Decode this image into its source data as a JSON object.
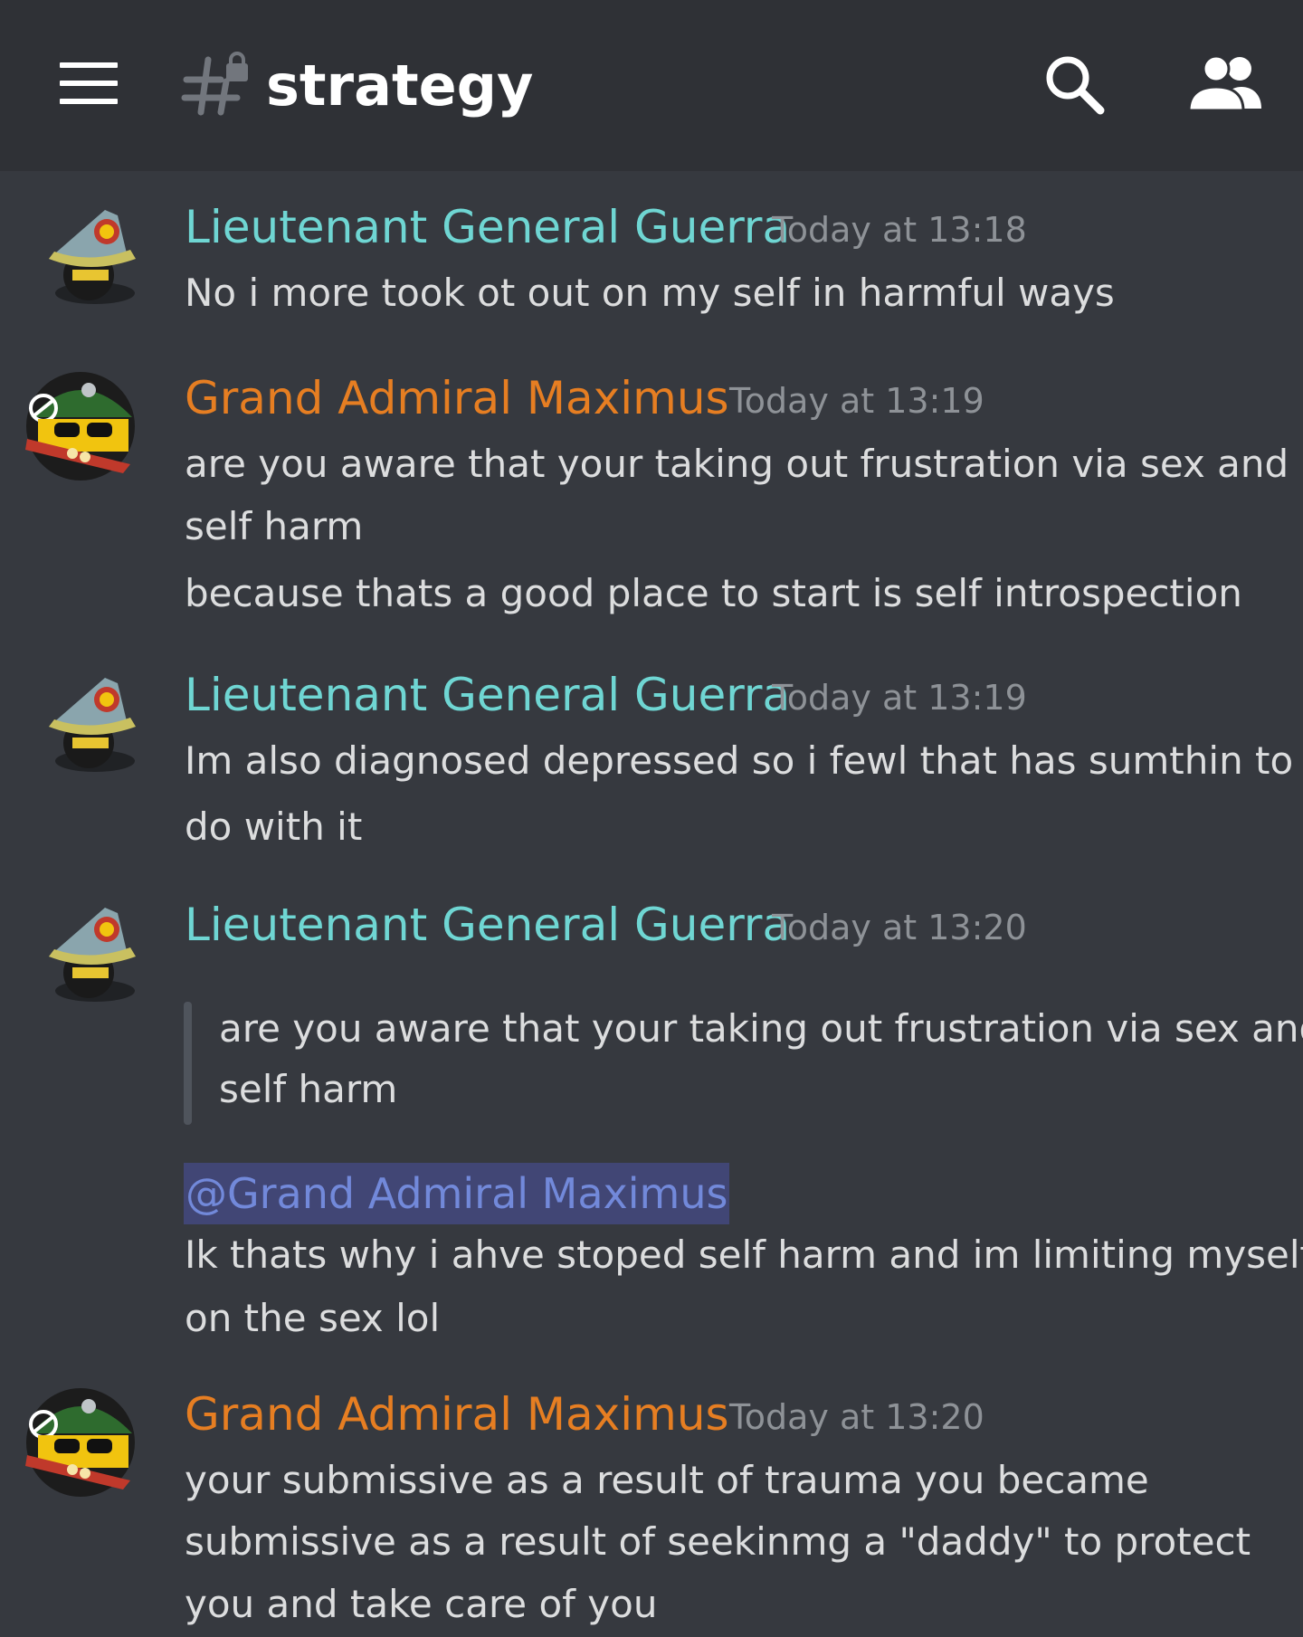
{
  "header": {
    "channel_name": "strategy",
    "menu_icon": "hamburger-menu-icon",
    "channel_icon": "locked-text-channel-icon",
    "search_icon": "search-icon",
    "members_icon": "members-icon"
  },
  "colors": {
    "header_bg": "#2f3136",
    "chat_bg": "#36393f",
    "name_teal": "#6fd6d3",
    "name_orange": "#e67e22",
    "mention_text": "#7289da",
    "mention_bg": "#414675"
  },
  "messages": [
    {
      "author": "Lieutenant General Guerra",
      "timestamp": "Today at 13:18",
      "lines": [
        "No i more took ot out on my self in harmful ways"
      ]
    },
    {
      "author": "Grand Admiral Maximus",
      "timestamp": "Today at 13:19",
      "lines": [
        "are you aware that your taking out frustration via sex and",
        "self harm",
        "because thats a good place to start is self introspection"
      ]
    },
    {
      "author": "Lieutenant General Guerra",
      "timestamp": "Today at 13:19",
      "lines": [
        "Im also diagnosed depressed so i fewl that has sumthin to",
        "do with it"
      ]
    },
    {
      "author": "Lieutenant General Guerra",
      "timestamp": "Today at 13:20",
      "quote_lines": [
        "are you aware that your taking out frustration via sex and",
        "self harm"
      ],
      "mention": "@Grand Admiral Maximus",
      "lines": [
        "Ik thats why i ahve stoped self harm and im limiting myself",
        "on the sex lol"
      ]
    },
    {
      "author": "Grand Admiral Maximus",
      "timestamp": "Today at 13:20",
      "lines": [
        "your submissive as a result of trauma you became",
        "submissive as a result of seekinmg a \"daddy\" to protect",
        "you and take care of you"
      ]
    }
  ]
}
